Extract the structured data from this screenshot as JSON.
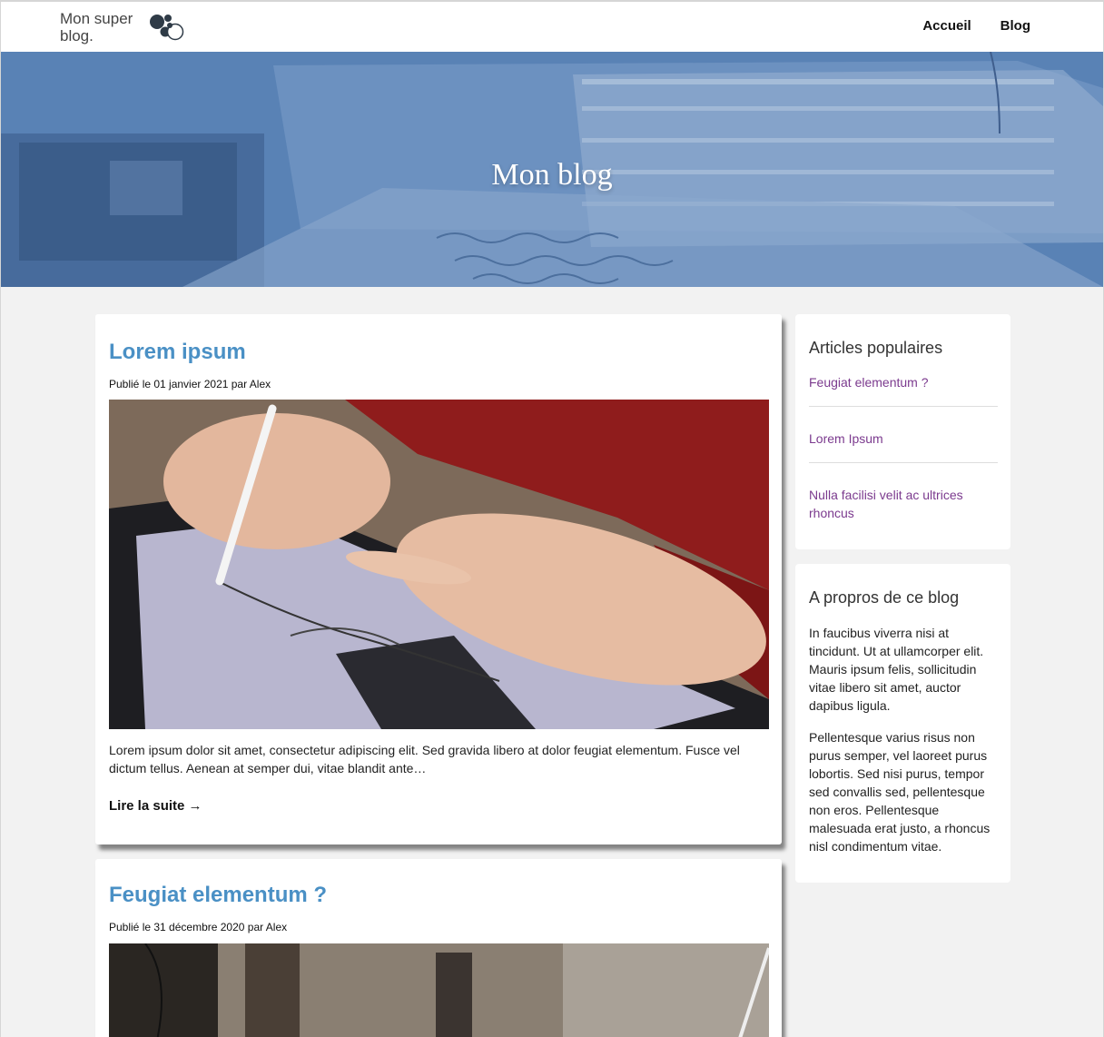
{
  "header": {
    "logo_text": "Mon super blog.",
    "nav": [
      "Accueil",
      "Blog"
    ]
  },
  "hero": {
    "title": "Mon blog"
  },
  "posts": [
    {
      "title": "Lorem ipsum",
      "meta": "Publié le 01 janvier 2021 par Alex",
      "image": "tablet-drawing-photo",
      "excerpt": "Lorem ipsum dolor sit amet, consectetur adipiscing elit. Sed gravida libero at dolor feugiat elementum. Fusce vel dictum tellus. Aenean at semper dui, vitae blandit ante…",
      "read_more": "Lire la suite →"
    },
    {
      "title": "Feugiat elementum ?",
      "meta": "Publié le 31 décembre 2020 par Alex",
      "image": "workspace-photo"
    }
  ],
  "sidebar": {
    "popular": {
      "title": "Articles populaires",
      "links": [
        "Feugiat elementum ?",
        "Lorem Ipsum",
        "Nulla facilisi velit ac ultrices rhoncus"
      ]
    },
    "about": {
      "title": "A propros de ce blog",
      "paragraphs": [
        "In faucibus viverra nisi at tincidunt. Ut at ullamcorper elit. Mauris ipsum felis, sollicitudin vitae libero sit amet, auctor dapibus ligula.",
        "Pellentesque varius risus non purus semper, vel laoreet purus lobortis. Sed nisi purus, tempor sed convallis sed, pellentesque non eros. Pellentesque malesuada erat justo, a rhoncus nisl condimentum vitae."
      ]
    }
  },
  "colors": {
    "title_blue": "#4a90c5",
    "link_purple": "#7b3a8e",
    "hero_tint": "#5f86b8",
    "page_bg": "#f2f2f2"
  }
}
